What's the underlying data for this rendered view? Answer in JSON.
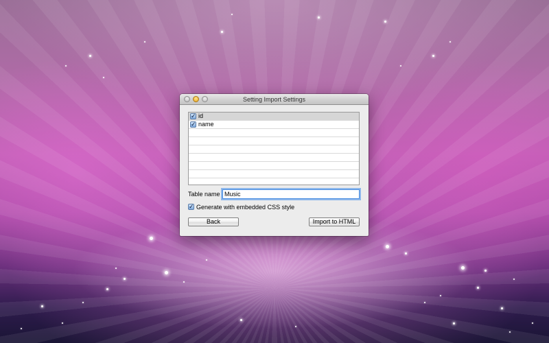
{
  "window": {
    "title": "Setting Import Settings"
  },
  "columns": [
    {
      "label": "id",
      "checked": true
    },
    {
      "label": "name",
      "checked": true
    }
  ],
  "form": {
    "table_name_label": "Table name",
    "table_name_value": "Music",
    "css_option_label": "Generate with embedded CSS style",
    "css_option_checked": true
  },
  "buttons": {
    "back_label": "Back",
    "import_label": "Import to HTML"
  },
  "icons": {
    "checkmark": "✓"
  }
}
